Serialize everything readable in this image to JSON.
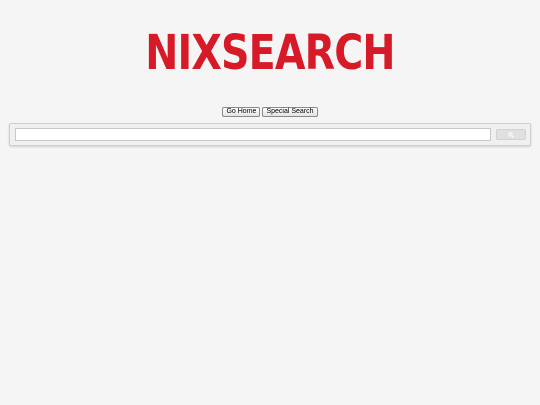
{
  "logo": {
    "text": "NIXSEARCH",
    "color": "#d71a27"
  },
  "nav": {
    "go_home_label": "Go Home",
    "special_search_label": "Special Search"
  },
  "search": {
    "value": "",
    "placeholder": "",
    "button_icon": "search-icon"
  },
  "colors": {
    "background": "#f5f5f5",
    "brand": "#d71a27"
  }
}
